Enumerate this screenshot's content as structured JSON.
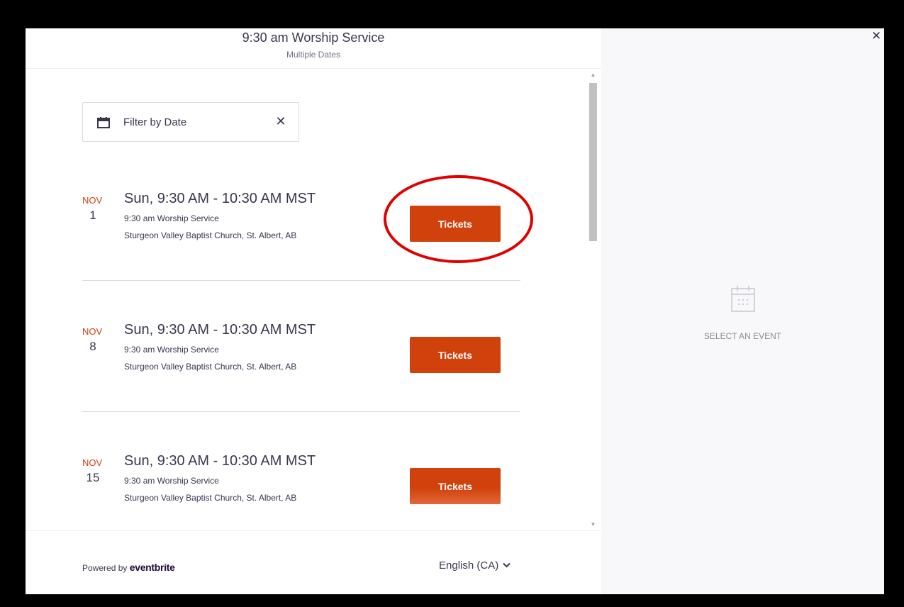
{
  "header": {
    "title": "9:30 am Worship Service",
    "subtitle": "Multiple Dates"
  },
  "filter": {
    "label": "Filter by Date",
    "icon": "calendar-icon",
    "clear_icon": "close-icon",
    "clear_glyph": "✕"
  },
  "events": [
    {
      "month": "NOV",
      "day": "1",
      "time": "Sun, 9:30 AM - 10:30 AM MST",
      "name": "9:30 am Worship Service",
      "venue": "Sturgeon Valley Baptist Church, St. Albert, AB",
      "button_label": "Tickets"
    },
    {
      "month": "NOV",
      "day": "8",
      "time": "Sun, 9:30 AM - 10:30 AM MST",
      "name": "9:30 am Worship Service",
      "venue": "Sturgeon Valley Baptist Church, St. Albert, AB",
      "button_label": "Tickets"
    },
    {
      "month": "NOV",
      "day": "15",
      "time": "Sun, 9:30 AM - 10:30 AM MST",
      "name": "9:30 am Worship Service",
      "venue": "Sturgeon Valley Baptist Church, St. Albert, AB",
      "button_label": "Tickets"
    }
  ],
  "footer": {
    "powered_prefix": "Powered by",
    "powered_brand": "eventbrite",
    "language": "English (CA)",
    "language_chevron": "⌄"
  },
  "side_panel": {
    "close_glyph": "✕",
    "empty_icon": "calendar-icon",
    "empty_label": "SELECT AN EVENT"
  },
  "scrollbar": {
    "up_glyph": "▲",
    "down_glyph": "▼"
  },
  "colors": {
    "brand_orange": "#d1410c",
    "highlight_red": "#e00000",
    "text_primary": "#39364f",
    "panel_bg": "#f8f7fa"
  }
}
